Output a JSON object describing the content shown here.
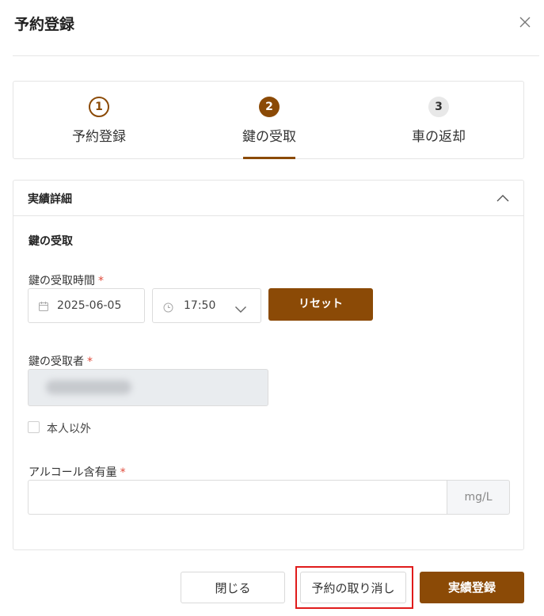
{
  "modal": {
    "title": "予約登録"
  },
  "stepper": {
    "steps": [
      {
        "number": "1",
        "label": "予約登録"
      },
      {
        "number": "2",
        "label": "鍵の受取"
      },
      {
        "number": "3",
        "label": "車の返却"
      }
    ],
    "active_step": 2
  },
  "panel": {
    "title": "実績詳細",
    "section_title": "鍵の受取",
    "pickup_time": {
      "label": "鍵の受取時間",
      "required_mark": "*",
      "date_value": "2025-06-05",
      "time_value": "17:50",
      "reset_label": "リセット"
    },
    "recipient": {
      "label": "鍵の受取者",
      "required_mark": "*"
    },
    "not_self": {
      "label": "本人以外",
      "checked": false
    },
    "alcohol": {
      "label": "アルコール含有量",
      "required_mark": "*",
      "value": "",
      "unit": "mg/L"
    }
  },
  "footer": {
    "close_label": "閉じる",
    "cancel_label": "予約の取り消し",
    "submit_label": "実績登録"
  },
  "colors": {
    "accent": "#8b4a06",
    "highlight": "#e01b1b"
  }
}
